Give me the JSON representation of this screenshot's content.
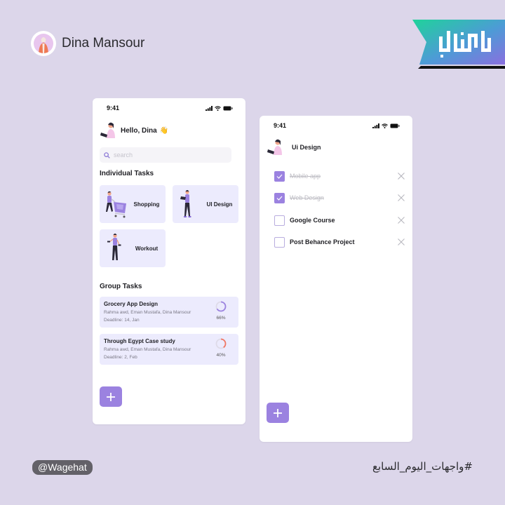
{
  "profile": {
    "name": "Dina Mansour",
    "avatar_icon": "woman-avatar-icon"
  },
  "brand": {
    "logo_icon": "wagehat-logo-icon",
    "logo_colors": [
      "#1fd39a",
      "#4d9bd6",
      "#8a6fdf"
    ]
  },
  "colors": {
    "background": "#dcd6ea",
    "accent": "#9b82e0",
    "card": "#ecebfd",
    "progress_1": "#9b82e0",
    "progress_2": "#f07663"
  },
  "home_screen": {
    "status_time": "9:41",
    "greeting": "Hello, Dina",
    "greeting_emoji": "👋",
    "search": {
      "placeholder": "search",
      "value": ""
    },
    "individual_section_title": "Individual Tasks",
    "individual_tasks": [
      {
        "label": "Shopping",
        "icon": "shopping-cart-illustration-icon"
      },
      {
        "label": "UI Design",
        "icon": "tablet-designer-illustration-icon"
      },
      {
        "label": "Workout",
        "icon": "dumbbell-workout-illustration-icon"
      }
    ],
    "group_section_title": "Group Tasks",
    "group_tasks": [
      {
        "title": "Grocery App Design",
        "members": "Rahma awd, Eman Mustafa, Dina Mansour",
        "deadline": "Deadline: 14, Jan",
        "progress_label": "66%",
        "progress": 0.66
      },
      {
        "title": "Through Egypt Case study",
        "members": "Rahma awd, Eman Mustafa, Dina Mansour",
        "deadline": "Deadline: 2, Feb",
        "progress_label": "40%",
        "progress": 0.4
      }
    ],
    "add_button_icon": "plus-icon"
  },
  "detail_screen": {
    "status_time": "9:41",
    "title": "Ui Design",
    "todos": [
      {
        "text": "Mobile app",
        "done": true
      },
      {
        "text": "Web Design",
        "done": true
      },
      {
        "text": "Google Course",
        "done": false
      },
      {
        "text": "Post Behance Project",
        "done": false
      }
    ],
    "add_button_icon": "plus-icon"
  },
  "footer": {
    "handle": "@Wagehat",
    "hashtag": "#واجهات_اليوم_السابع"
  }
}
